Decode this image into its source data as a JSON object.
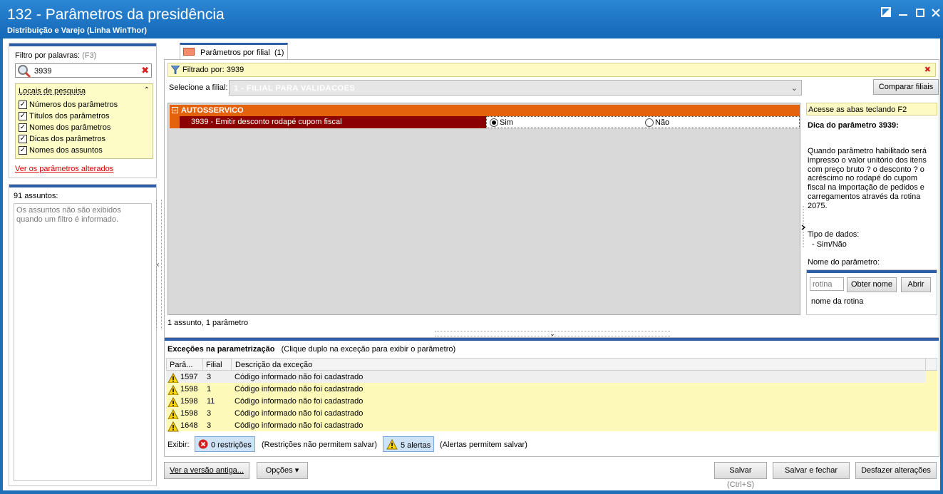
{
  "window": {
    "title": "132 - Parâmetros da presidência",
    "subtitle": "Distribuição e Varejo (Linha WinThor)",
    "controls": [
      "restore-icon",
      "minimize-icon",
      "maximize-icon",
      "close-icon"
    ]
  },
  "filter": {
    "label": "Filtro por palavras:",
    "hotkey": "(F3)",
    "value": "3939"
  },
  "locais": {
    "title": "Locais de pesquisa",
    "items": [
      {
        "label": "Números dos parâmetros",
        "checked": true
      },
      {
        "label": "Títulos dos parâmetros",
        "checked": true
      },
      {
        "label": "Nomes dos parâmetros",
        "checked": true
      },
      {
        "label": "Dicas dos parâmetros",
        "checked": true
      },
      {
        "label": "Nomes dos assuntos",
        "checked": true
      }
    ],
    "changed_link": "Ver os parâmetros alterados"
  },
  "subjects": {
    "count": "91 assuntos:",
    "empty_msg": "Os assuntos não são exibidos quando um filtro é informado."
  },
  "tab": {
    "label": "Parâmetros por filial",
    "count": "(1)"
  },
  "filtered_by": "Filtrado por: 3939",
  "filial": {
    "label": "Selecione a filial:",
    "value": "1 - FILIAL PARA VALIDACOES",
    "compare_button": "Comparar filiais"
  },
  "group": {
    "title": "AUTOSSERVICO",
    "param_name": "3939 - Emitir desconto rodapé cupom fiscal",
    "option_yes": "Sim",
    "option_no": "Não",
    "selected": "Sim"
  },
  "count_line": "1 assunto, 1 parâmetro",
  "hint": {
    "f2": "Acesse as abas teclando F2",
    "title": "Dica do parâmetro 3939:",
    "text": "Quando parâmetro habilitado será impresso o valor unitório dos itens com preço bruto ? o desconto ? o acréscimo no rodapé do cupom fiscal na importação de pedidos e carregamentos através da rotina 2075.",
    "tipo_label": "Tipo de dados:",
    "tipo_value": "- Sim/Não",
    "nome_label": "Nome do parâmetro:",
    "rotina_placeholder": "rotina",
    "obter_button": "Obter nome",
    "abrir_button": "Abrir",
    "rotina_name": "nome da rotina"
  },
  "exceptions": {
    "title": "Exceções na parametrização",
    "subtitle": "(Clique duplo na exceção para exibir o parâmetro)",
    "columns": [
      "Parâ...",
      "Filial",
      "Descrição da exceção"
    ],
    "rows": [
      {
        "param": "1597",
        "filial": "3",
        "desc": "Código informado não foi cadastrado"
      },
      {
        "param": "1598",
        "filial": "1",
        "desc": "Código informado não foi cadastrado"
      },
      {
        "param": "1598",
        "filial": "11",
        "desc": "Código informado não foi cadastrado"
      },
      {
        "param": "1598",
        "filial": "3",
        "desc": "Código informado não foi cadastrado"
      },
      {
        "param": "1648",
        "filial": "3",
        "desc": "Código informado não foi cadastrado"
      }
    ],
    "exibir_label": "Exibir:",
    "restricoes_chip": "0 restrições",
    "restricoes_note": "(Restrições não permitem salvar)",
    "alertas_chip": "5 alertas",
    "alertas_note": "(Alertas permitem salvar)"
  },
  "footer": {
    "old_version": "Ver a versão antiga...",
    "options": "Opções",
    "save": "Salvar",
    "save_hint": "(Ctrl+S)",
    "save_close": "Salvar e fechar",
    "undo": "Desfazer alterações"
  },
  "colors": {
    "titlebar": "#1f6fb8",
    "group_header": "#e4620c",
    "selected_param": "#8b0000",
    "hint_yellow": "#fdfac4",
    "accent_blue": "#2f5ea9"
  }
}
